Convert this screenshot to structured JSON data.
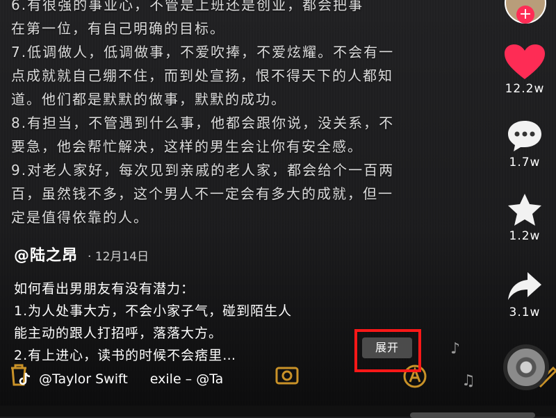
{
  "video_text_lines": [
    "6.有很强的事业心，不管是上班还是创业，都会把事",
    "在第一位，有自己明确的目标。",
    "7.低调做人，低调做事，不爱吹捧，不爱炫耀。不会有一",
    "点成就就自己绷不住，而到处宣扬，恨不得天下的人都知",
    "道。他们都是默默的做事，默默的成功。",
    "8.有担当，不管遇到什么事，他都会跟你说，没关系，不",
    "要急，他会帮忙解决，这样的男生会让你有安全感。",
    "9.对老人家好，每次见到亲戚的老人家，都会给个一百两",
    "百，虽然钱不多，这个男人不一定会有多大的成就，但一",
    "定是值得依靠的人。"
  ],
  "caption": {
    "author": "@陆之昂",
    "date": "· 12月14日",
    "lines": [
      "如何看出男朋友有没有潜力：",
      "1.为人处事大方，不会小家子气，碰到陌生人",
      "能主动的跟人打招呼，落落大方。",
      "2.有上进心，读书的时候不会痞里…"
    ],
    "expand_label": "展开"
  },
  "music": {
    "artist": "@Taylor Swift",
    "track": "exile – @Ta"
  },
  "sidebar": {
    "follow_symbol": "+",
    "like_count": "12.2w",
    "comment_count": "1.7w",
    "favorite_count": "1.2w",
    "share_count": "3.1w"
  },
  "colors": {
    "accent_red": "#fe2c55",
    "highlight_box": "#ff1818",
    "decor_orange": "#d49a2a"
  }
}
